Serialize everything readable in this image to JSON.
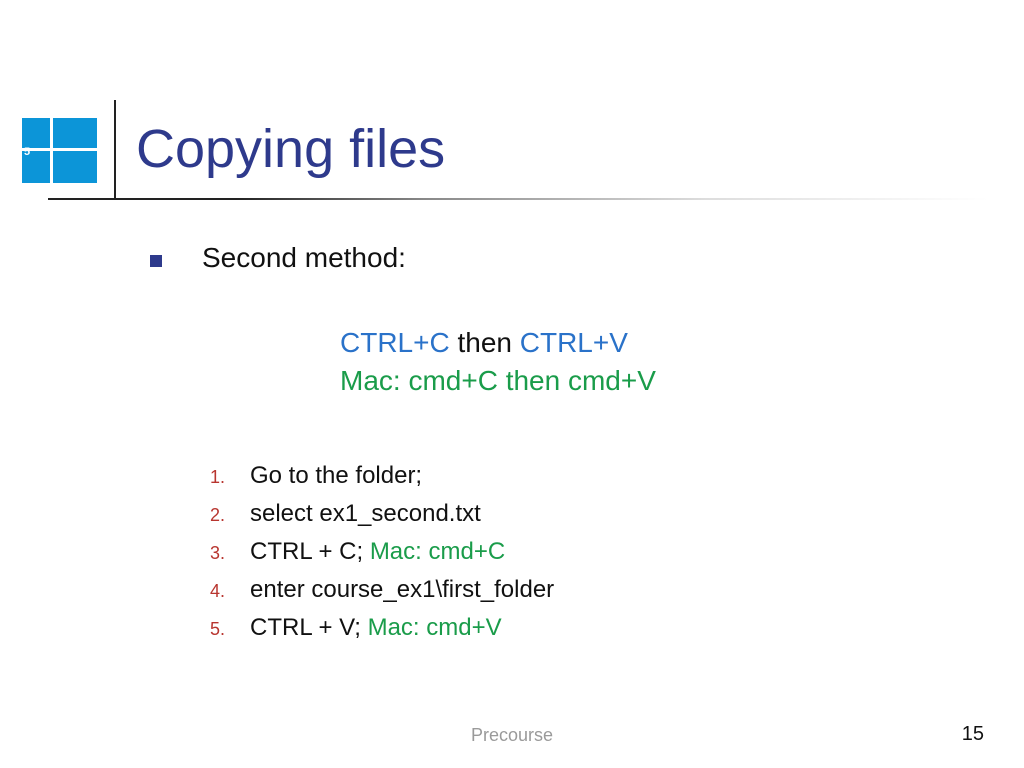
{
  "slide_badge": "5",
  "title": "Copying files",
  "bullet": "Second method:",
  "shortcut": {
    "win_copy": "CTRL+C",
    "middle": "   then  ",
    "win_paste": "CTRL+V",
    "mac_line": "Mac: cmd+C   then  cmd+V"
  },
  "steps": [
    {
      "num": "1.",
      "text": "Go to the folder;",
      "mac": ""
    },
    {
      "num": "2.",
      "text": "select ex1_second.txt",
      "mac": ""
    },
    {
      "num": "3.",
      "text": "CTRL + C;  ",
      "mac": "Mac: cmd+C"
    },
    {
      "num": "4.",
      "text": "enter course_ex1\\first_folder",
      "mac": ""
    },
    {
      "num": "5.",
      "text": "CTRL + V;  ",
      "mac": "Mac: cmd+V"
    }
  ],
  "footer_label": "Precourse",
  "page_number": "15"
}
